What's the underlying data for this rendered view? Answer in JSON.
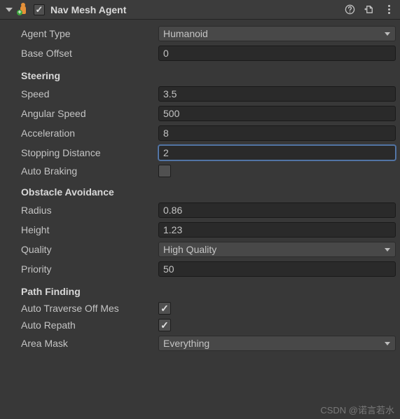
{
  "header": {
    "title": "Nav Mesh Agent",
    "enabled": true
  },
  "fields": {
    "agentType": {
      "label": "Agent Type",
      "value": "Humanoid"
    },
    "baseOffset": {
      "label": "Base Offset",
      "value": "0"
    }
  },
  "steering": {
    "title": "Steering",
    "speed": {
      "label": "Speed",
      "value": "3.5"
    },
    "angularSpeed": {
      "label": "Angular Speed",
      "value": "500"
    },
    "acceleration": {
      "label": "Acceleration",
      "value": "8"
    },
    "stoppingDistance": {
      "label": "Stopping Distance",
      "value": "2"
    },
    "autoBraking": {
      "label": "Auto Braking",
      "checked": false
    }
  },
  "obstacle": {
    "title": "Obstacle Avoidance",
    "radius": {
      "label": "Radius",
      "value": "0.86"
    },
    "height": {
      "label": "Height",
      "value": "1.23"
    },
    "quality": {
      "label": "Quality",
      "value": "High Quality"
    },
    "priority": {
      "label": "Priority",
      "value": "50"
    }
  },
  "pathFinding": {
    "title": "Path Finding",
    "autoTraverse": {
      "label": "Auto Traverse Off Mes",
      "checked": true
    },
    "autoRepath": {
      "label": "Auto Repath",
      "checked": true
    },
    "areaMask": {
      "label": "Area Mask",
      "value": "Everything"
    }
  },
  "watermark": "CSDN @诺言若水"
}
